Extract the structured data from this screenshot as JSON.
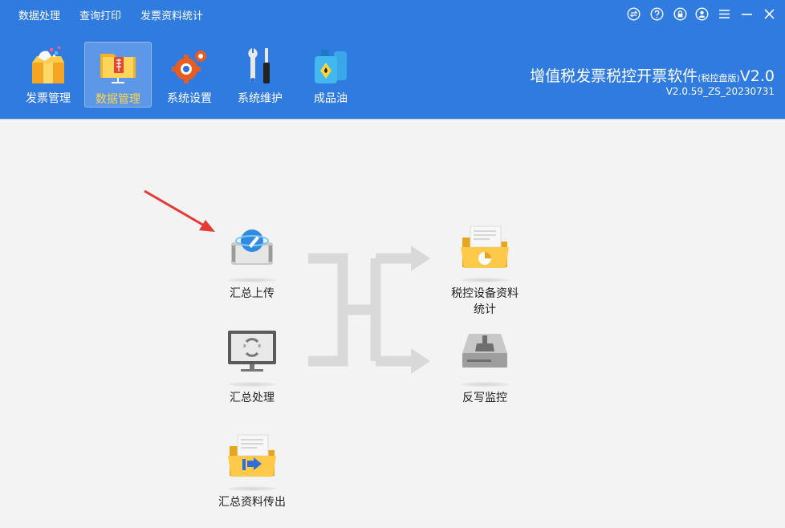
{
  "menu": [
    {
      "label": "数据处理"
    },
    {
      "label": "查询打印"
    },
    {
      "label": "发票资料统计"
    }
  ],
  "window_controls": [
    {
      "icon": "switch-icon"
    },
    {
      "icon": "help-icon"
    },
    {
      "icon": "lock-icon"
    },
    {
      "icon": "user-icon"
    },
    {
      "icon": "menu-icon"
    },
    {
      "icon": "minimize-icon"
    },
    {
      "icon": "close-icon"
    }
  ],
  "toolbar": [
    {
      "label": "发票管理",
      "icon": "invoice-box-icon",
      "active": false
    },
    {
      "label": "数据管理",
      "icon": "data-folder-icon",
      "active": true
    },
    {
      "label": "系统设置",
      "icon": "gears-icon",
      "active": false
    },
    {
      "label": "系统维护",
      "icon": "tools-icon",
      "active": false
    },
    {
      "label": "成品油",
      "icon": "oil-can-icon",
      "active": false
    }
  ],
  "app": {
    "title": "增值税发票税控开票软件",
    "edition": "(税控盘版)",
    "title_suffix": "V2.0",
    "version": "V2.0.59_ZS_20230731"
  },
  "functions": {
    "upload": {
      "label": "汇总上传",
      "icon": "upload-browser-icon"
    },
    "process": {
      "label": "汇总处理",
      "icon": "monitor-refresh-icon"
    },
    "export": {
      "label": "汇总资料传出",
      "icon": "folder-export-icon"
    },
    "stats": {
      "label": "税控设备资料统计",
      "icon": "folder-chart-icon"
    },
    "monitor": {
      "label": "反写监控",
      "icon": "disk-broom-icon"
    }
  },
  "colors": {
    "header": "#2f7be0",
    "active_label": "#ffd54a",
    "arrow": "#e53935",
    "flow": "#d9d9d9"
  }
}
